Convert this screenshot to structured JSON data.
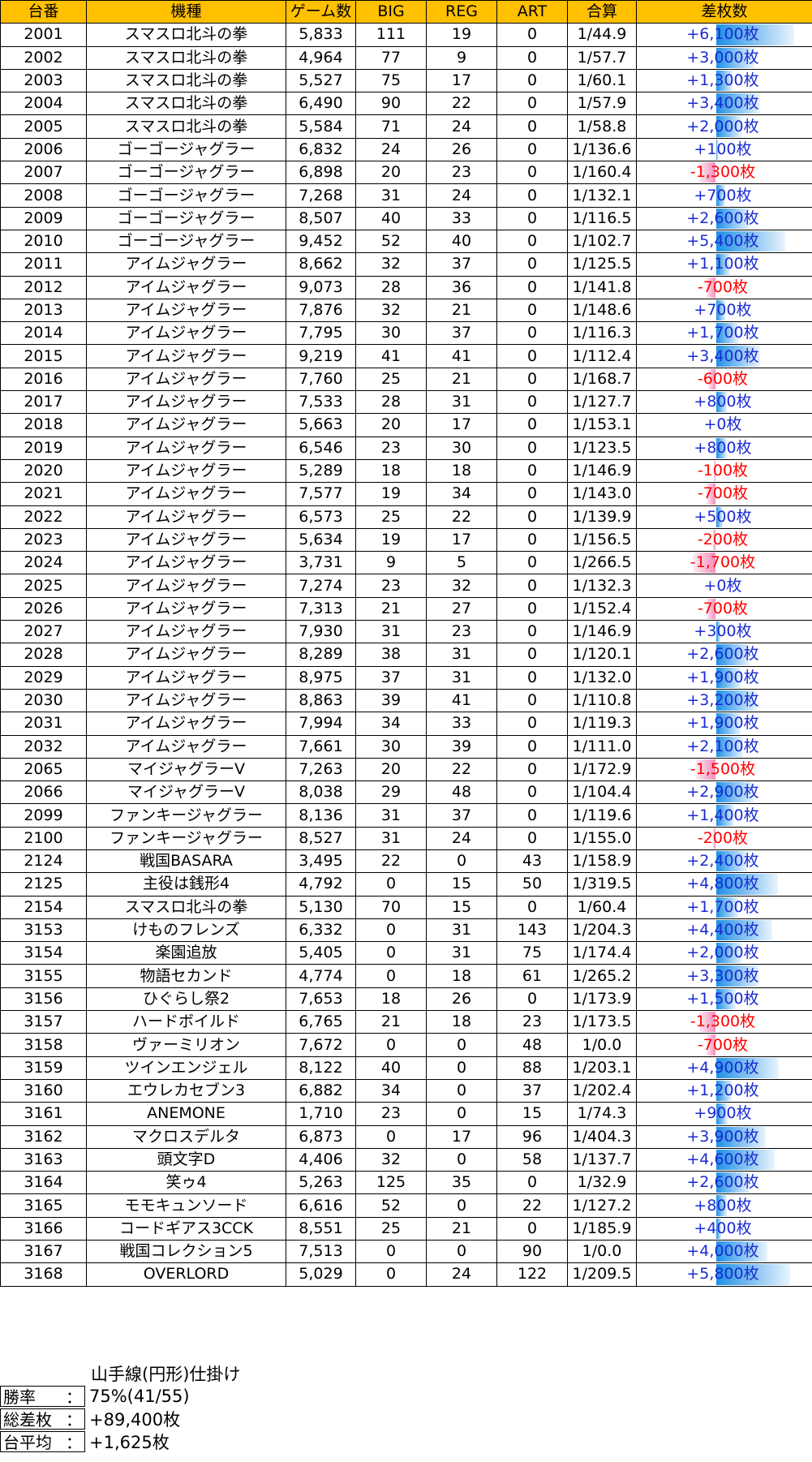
{
  "headers": [
    "台番",
    "機種",
    "ゲーム数",
    "BIG",
    "REG",
    "ART",
    "合算",
    "差枚数"
  ],
  "rows": [
    [
      "2001",
      "スマスロ北斗の拳",
      "5,833",
      "111",
      "19",
      "0",
      "1/44.9",
      "+6,100枚"
    ],
    [
      "2002",
      "スマスロ北斗の拳",
      "4,964",
      "77",
      "9",
      "0",
      "1/57.7",
      "+3,000枚"
    ],
    [
      "2003",
      "スマスロ北斗の拳",
      "5,527",
      "75",
      "17",
      "0",
      "1/60.1",
      "+1,300枚"
    ],
    [
      "2004",
      "スマスロ北斗の拳",
      "6,490",
      "90",
      "22",
      "0",
      "1/57.9",
      "+3,400枚"
    ],
    [
      "2005",
      "スマスロ北斗の拳",
      "5,584",
      "71",
      "24",
      "0",
      "1/58.8",
      "+2,000枚"
    ],
    [
      "2006",
      "ゴーゴージャグラー",
      "6,832",
      "24",
      "26",
      "0",
      "1/136.6",
      "+100枚"
    ],
    [
      "2007",
      "ゴーゴージャグラー",
      "6,898",
      "20",
      "23",
      "0",
      "1/160.4",
      "-1,300枚"
    ],
    [
      "2008",
      "ゴーゴージャグラー",
      "7,268",
      "31",
      "24",
      "0",
      "1/132.1",
      "+700枚"
    ],
    [
      "2009",
      "ゴーゴージャグラー",
      "8,507",
      "40",
      "33",
      "0",
      "1/116.5",
      "+2,600枚"
    ],
    [
      "2010",
      "ゴーゴージャグラー",
      "9,452",
      "52",
      "40",
      "0",
      "1/102.7",
      "+5,400枚"
    ],
    [
      "2011",
      "アイムジャグラー",
      "8,662",
      "32",
      "37",
      "0",
      "1/125.5",
      "+1,100枚"
    ],
    [
      "2012",
      "アイムジャグラー",
      "9,073",
      "28",
      "36",
      "0",
      "1/141.8",
      "-700枚"
    ],
    [
      "2013",
      "アイムジャグラー",
      "7,876",
      "32",
      "21",
      "0",
      "1/148.6",
      "+700枚"
    ],
    [
      "2014",
      "アイムジャグラー",
      "7,795",
      "30",
      "37",
      "0",
      "1/116.3",
      "+1,700枚"
    ],
    [
      "2015",
      "アイムジャグラー",
      "9,219",
      "41",
      "41",
      "0",
      "1/112.4",
      "+3,400枚"
    ],
    [
      "2016",
      "アイムジャグラー",
      "7,760",
      "25",
      "21",
      "0",
      "1/168.7",
      "-600枚"
    ],
    [
      "2017",
      "アイムジャグラー",
      "7,533",
      "28",
      "31",
      "0",
      "1/127.7",
      "+800枚"
    ],
    [
      "2018",
      "アイムジャグラー",
      "5,663",
      "20",
      "17",
      "0",
      "1/153.1",
      "+0枚"
    ],
    [
      "2019",
      "アイムジャグラー",
      "6,546",
      "23",
      "30",
      "0",
      "1/123.5",
      "+800枚"
    ],
    [
      "2020",
      "アイムジャグラー",
      "5,289",
      "18",
      "18",
      "0",
      "1/146.9",
      "-100枚"
    ],
    [
      "2021",
      "アイムジャグラー",
      "7,577",
      "19",
      "34",
      "0",
      "1/143.0",
      "-700枚"
    ],
    [
      "2022",
      "アイムジャグラー",
      "6,573",
      "25",
      "22",
      "0",
      "1/139.9",
      "+500枚"
    ],
    [
      "2023",
      "アイムジャグラー",
      "5,634",
      "19",
      "17",
      "0",
      "1/156.5",
      "-200枚"
    ],
    [
      "2024",
      "アイムジャグラー",
      "3,731",
      "9",
      "5",
      "0",
      "1/266.5",
      "-1,700枚"
    ],
    [
      "2025",
      "アイムジャグラー",
      "7,274",
      "23",
      "32",
      "0",
      "1/132.3",
      "+0枚"
    ],
    [
      "2026",
      "アイムジャグラー",
      "7,313",
      "21",
      "27",
      "0",
      "1/152.4",
      "-700枚"
    ],
    [
      "2027",
      "アイムジャグラー",
      "7,930",
      "31",
      "23",
      "0",
      "1/146.9",
      "+300枚"
    ],
    [
      "2028",
      "アイムジャグラー",
      "8,289",
      "38",
      "31",
      "0",
      "1/120.1",
      "+2,600枚"
    ],
    [
      "2029",
      "アイムジャグラー",
      "8,975",
      "37",
      "31",
      "0",
      "1/132.0",
      "+1,900枚"
    ],
    [
      "2030",
      "アイムジャグラー",
      "8,863",
      "39",
      "41",
      "0",
      "1/110.8",
      "+3,200枚"
    ],
    [
      "2031",
      "アイムジャグラー",
      "7,994",
      "34",
      "33",
      "0",
      "1/119.3",
      "+1,900枚"
    ],
    [
      "2032",
      "アイムジャグラー",
      "7,661",
      "30",
      "39",
      "0",
      "1/111.0",
      "+2,100枚"
    ],
    [
      "2065",
      "マイジャグラーV",
      "7,263",
      "20",
      "22",
      "0",
      "1/172.9",
      "-1,500枚"
    ],
    [
      "2066",
      "マイジャグラーV",
      "8,038",
      "29",
      "48",
      "0",
      "1/104.4",
      "+2,900枚"
    ],
    [
      "2099",
      "ファンキージャグラー",
      "8,136",
      "31",
      "37",
      "0",
      "1/119.6",
      "+1,400枚"
    ],
    [
      "2100",
      "ファンキージャグラー",
      "8,527",
      "31",
      "24",
      "0",
      "1/155.0",
      "-200枚"
    ],
    [
      "2124",
      "戦国BASARA",
      "3,495",
      "22",
      "0",
      "43",
      "1/158.9",
      "+2,400枚"
    ],
    [
      "2125",
      "主役は銭形4",
      "4,792",
      "0",
      "15",
      "50",
      "1/319.5",
      "+4,800枚"
    ],
    [
      "2154",
      "スマスロ北斗の拳",
      "5,130",
      "70",
      "15",
      "0",
      "1/60.4",
      "+1,700枚"
    ],
    [
      "3153",
      "けものフレンズ",
      "6,332",
      "0",
      "31",
      "143",
      "1/204.3",
      "+4,400枚"
    ],
    [
      "3154",
      "楽園追放",
      "5,405",
      "0",
      "31",
      "75",
      "1/174.4",
      "+2,000枚"
    ],
    [
      "3155",
      "物語セカンド",
      "4,774",
      "0",
      "18",
      "61",
      "1/265.2",
      "+3,300枚"
    ],
    [
      "3156",
      "ひぐらし祭2",
      "7,653",
      "18",
      "26",
      "0",
      "1/173.9",
      "+1,500枚"
    ],
    [
      "3157",
      "ハードボイルド",
      "6,765",
      "21",
      "18",
      "23",
      "1/173.5",
      "-1,300枚"
    ],
    [
      "3158",
      "ヴァーミリオン",
      "7,672",
      "0",
      "0",
      "48",
      "1/0.0",
      "-700枚"
    ],
    [
      "3159",
      "ツインエンジェル",
      "8,122",
      "40",
      "0",
      "88",
      "1/203.1",
      "+4,900枚"
    ],
    [
      "3160",
      "エウレカセブン3",
      "6,882",
      "34",
      "0",
      "37",
      "1/202.4",
      "+1,200枚"
    ],
    [
      "3161",
      "ANEMONE",
      "1,710",
      "23",
      "0",
      "15",
      "1/74.3",
      "+900枚"
    ],
    [
      "3162",
      "マクロスデルタ",
      "6,873",
      "0",
      "17",
      "96",
      "1/404.3",
      "+3,900枚"
    ],
    [
      "3163",
      "頭文字D",
      "4,406",
      "32",
      "0",
      "58",
      "1/137.7",
      "+4,600枚"
    ],
    [
      "3164",
      "笑ゥ4",
      "5,263",
      "125",
      "35",
      "0",
      "1/32.9",
      "+2,600枚"
    ],
    [
      "3165",
      "モモキュンソード",
      "6,616",
      "52",
      "0",
      "22",
      "1/127.2",
      "+800枚"
    ],
    [
      "3166",
      "コードギアス3CCK",
      "8,551",
      "25",
      "21",
      "0",
      "1/185.9",
      "+400枚"
    ],
    [
      "3167",
      "戦国コレクション5",
      "7,513",
      "0",
      "0",
      "90",
      "1/0.0",
      "+4,000枚"
    ],
    [
      "3168",
      "OVERLORD",
      "5,029",
      "0",
      "24",
      "122",
      "1/209.5",
      "+5,800枚"
    ]
  ],
  "diff_values": [
    6100,
    3000,
    1300,
    3400,
    2000,
    100,
    -1300,
    700,
    2600,
    5400,
    1100,
    -700,
    700,
    1700,
    3400,
    -600,
    800,
    0,
    800,
    -100,
    -700,
    500,
    -200,
    -1700,
    0,
    -700,
    300,
    2600,
    1900,
    3200,
    1900,
    2100,
    -1500,
    2900,
    1400,
    -200,
    2400,
    4800,
    1700,
    4400,
    2000,
    3300,
    1500,
    -1300,
    -700,
    4900,
    1200,
    900,
    3900,
    4600,
    2600,
    800,
    400,
    4000,
    5800
  ],
  "summary": {
    "title": "山手線(円形)仕掛け",
    "rows": [
      {
        "key": "勝率",
        "colon": "：",
        "value": "75%(41/55)"
      },
      {
        "key": "総差枚",
        "colon": "：",
        "value": "+89,400枚"
      },
      {
        "key": "台平均",
        "colon": "：",
        "value": "+1,625枚"
      }
    ]
  },
  "colors": {
    "header": "#ffc000",
    "positive_text": "#1a2bd1",
    "negative_text": "#ff0000",
    "positive_bar": "#1f8fe6",
    "negative_bar": "#f58cba"
  }
}
